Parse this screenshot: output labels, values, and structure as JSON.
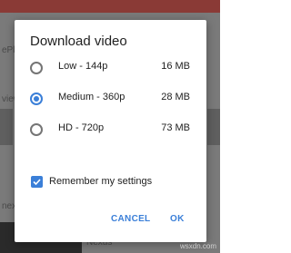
{
  "dialog": {
    "title": "Download video",
    "options": [
      {
        "label": "Low - 144p",
        "size": "16 MB",
        "selected": false
      },
      {
        "label": "Medium - 360p",
        "size": "28 MB",
        "selected": true
      },
      {
        "label": "HD - 720p",
        "size": "73 MB",
        "selected": false
      }
    ],
    "remember_label": "Remember my settings",
    "remember_checked": true,
    "cancel_label": "CANCEL",
    "ok_label": "OK"
  },
  "background": {
    "fragments": [
      "ePl",
      "view",
      "next",
      "Nexus"
    ]
  },
  "watermark": "wsxdn.com",
  "colors": {
    "accent": "#3b7fd8",
    "scrim": "#6e6e6e"
  }
}
